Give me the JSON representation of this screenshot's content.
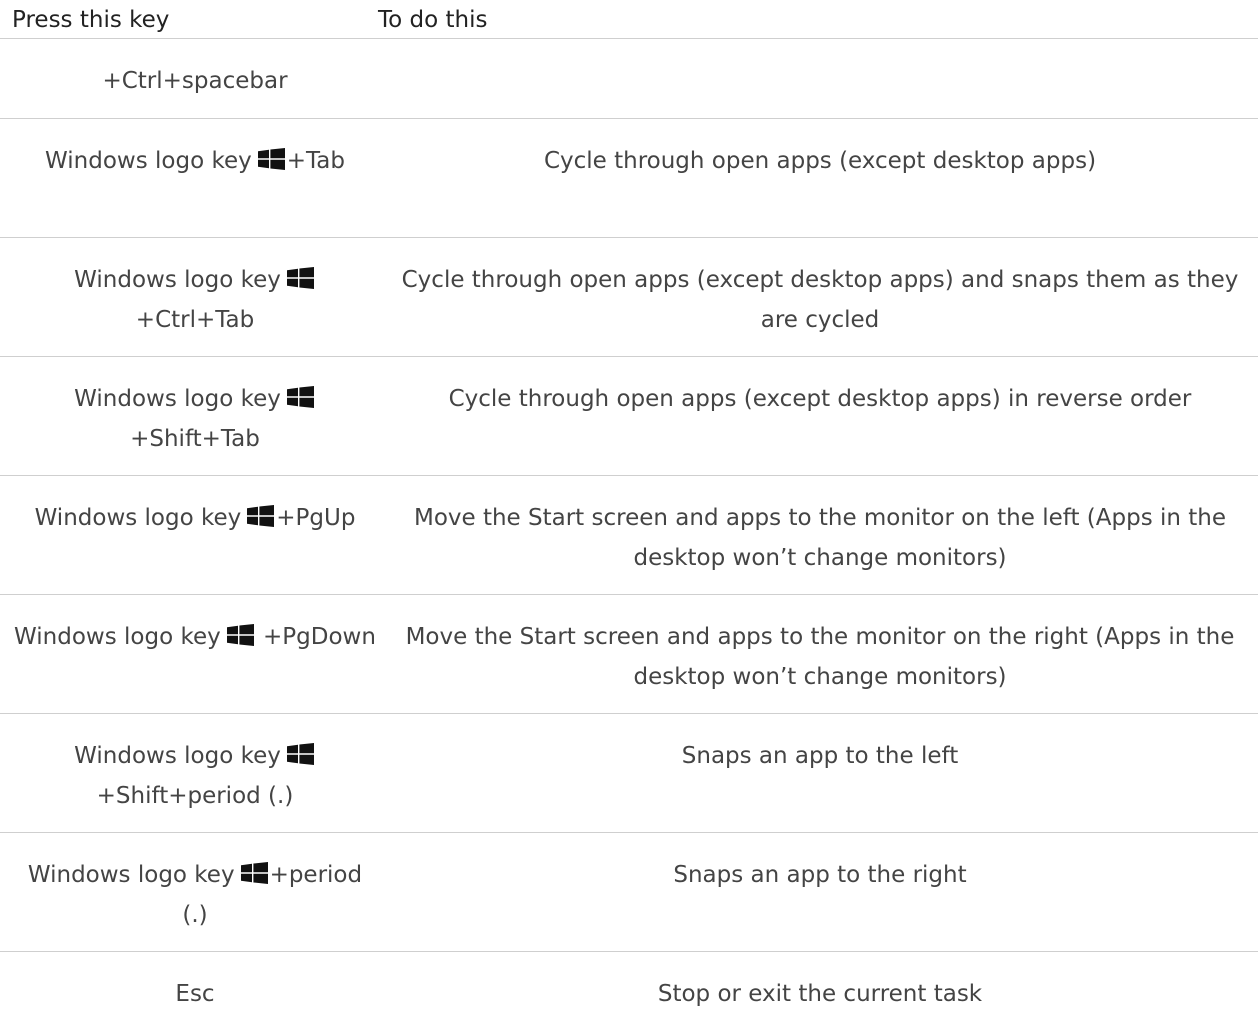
{
  "header": {
    "key_col": "Press this key",
    "action_col": "To do this"
  },
  "rows": [
    {
      "key_prefix": "",
      "key_suffix": "+Ctrl+spacebar",
      "action": ""
    },
    {
      "key_prefix": "Windows logo key",
      "key_suffix": "+Tab",
      "action": "Cycle through open apps (except desktop apps)"
    },
    {
      "key_prefix": "Windows logo key",
      "key_suffix": "+Ctrl+Tab",
      "action": "Cycle through open apps (except desktop apps) and snaps them as they are cycled"
    },
    {
      "key_prefix": "Windows logo key",
      "key_suffix": "+Shift+Tab",
      "action": "Cycle through open apps (except desktop apps) in reverse order"
    },
    {
      "key_prefix": "Windows logo key",
      "key_suffix": "+PgUp",
      "action": "Move the Start screen and apps to the monitor on the left (Apps in the desktop won’t change monitors)"
    },
    {
      "key_prefix": "Windows logo key",
      "key_suffix": "+PgDown",
      "action": "Move the Start screen and apps to the monitor on the right (Apps in the desktop won’t change monitors)"
    },
    {
      "key_prefix": "Windows logo key",
      "key_suffix": "+Shift+period (.)",
      "action": "Snaps an app to the left"
    },
    {
      "key_prefix": "Windows logo key",
      "key_suffix": "+period (.)",
      "action": "Snaps an app to the right"
    },
    {
      "key_prefix": "",
      "key_suffix": "Esc",
      "action": "Stop or exit the current task"
    }
  ],
  "icons": {
    "windows_logo": "windows-logo-icon"
  },
  "colors": {
    "text": "#444444",
    "header_text": "#222222",
    "divider": "#cfcfcf",
    "icon": "#111111"
  }
}
